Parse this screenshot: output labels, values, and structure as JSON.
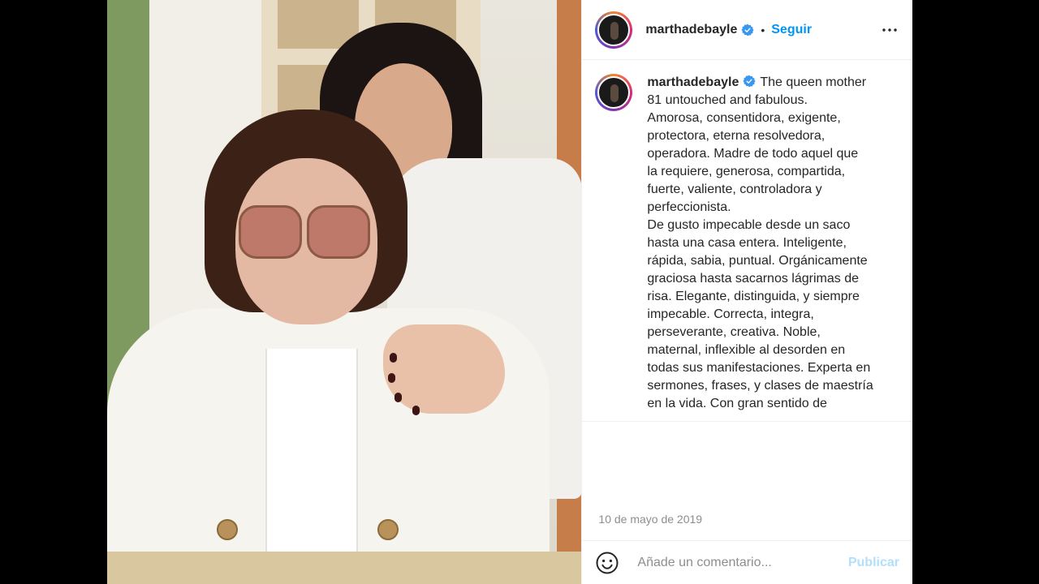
{
  "post": {
    "username": "marthadebayle",
    "verified": true,
    "follow_label": "Seguir",
    "separator": "•",
    "caption": "The queen mother\n81 untouched and fabulous.\nAmorosa, consentidora, exigente,\nprotectora, eterna resolvedora,\noperadora. Madre de todo aquel que\nla requiere, generosa, compartida,\nfuerte, valiente, controladora y\nperfeccionista.\nDe gusto impecable desde un saco\nhasta una casa entera. Inteligente,\nrápida, sabia, puntual. Orgánicamente\ngraciosa hasta sacarnos lágrimas de\nrisa. Elegante, distinguida, y siempre\nimpecable. Correcta, integra,\nperseverante, creativa. Noble,\nmaternal, inflexible al desorden en\ntodas sus manifestaciones. Experta en\nsermones, frases, y clases de maestría\nen la vida. Con gran sentido de",
    "date": "10 de mayo de 2019"
  },
  "comment": {
    "placeholder": "Añade un comentario...",
    "publish_label": "Publicar"
  },
  "icons": {
    "verified": "verified-badge-icon",
    "more": "more-options-icon",
    "emoji": "emoji-icon"
  },
  "colors": {
    "accent": "#0095f6",
    "publish_disabled": "#b2dffc",
    "muted": "#8e8e8e",
    "text": "#262626"
  }
}
